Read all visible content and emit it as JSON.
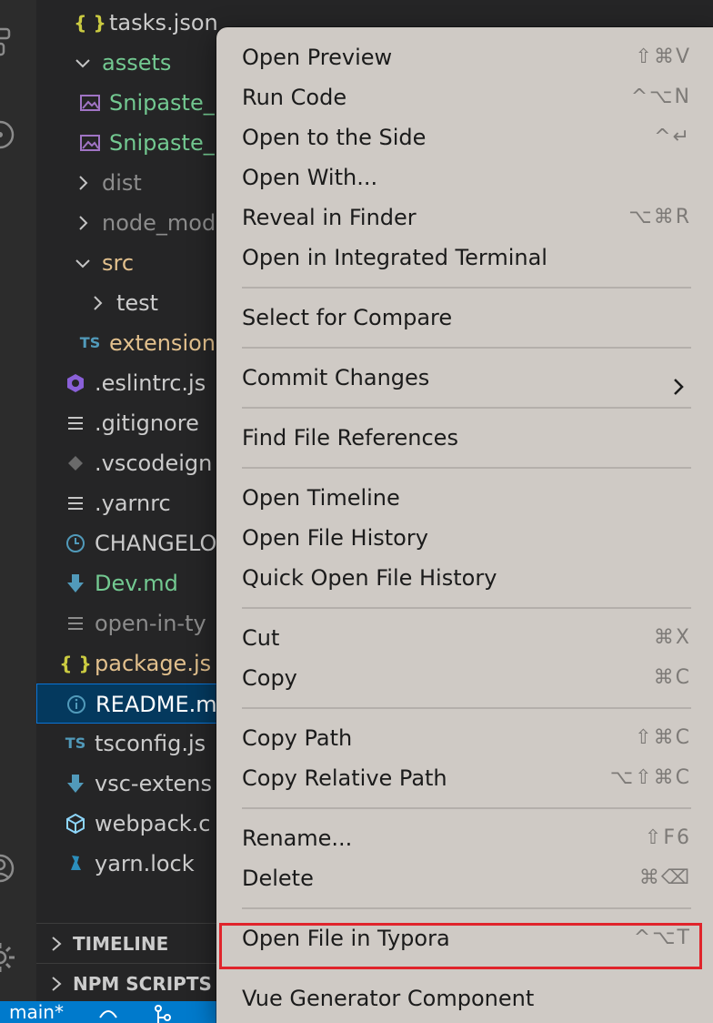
{
  "explorer": {
    "tree": [
      {
        "label": "tasks.json",
        "icon": "json-braces-icon",
        "icon_glyph": "{ }",
        "color": "#cccccc",
        "icon_color": "#cbcb41"
      },
      {
        "label": "assets",
        "icon": "chevron-down-icon",
        "color": "#73c991"
      },
      {
        "label": "Snipaste_",
        "icon": "image-icon",
        "color": "#73c991",
        "icon_color": "#a074c4"
      },
      {
        "label": "Snipaste_",
        "icon": "image-icon",
        "color": "#73c991",
        "icon_color": "#a074c4"
      },
      {
        "label": "dist",
        "icon": "chevron-right-icon",
        "color": "#8c8c8c"
      },
      {
        "label": "node_mod",
        "icon": "chevron-right-icon",
        "color": "#8c8c8c"
      },
      {
        "label": "src",
        "icon": "chevron-down-icon",
        "color": "#e2c08d"
      },
      {
        "label": "test",
        "icon": "chevron-right-icon",
        "color": "#cccccc"
      },
      {
        "label": "extension",
        "icon": "typescript-icon",
        "icon_glyph": "TS",
        "color": "#e2c08d",
        "icon_color": "#519aba"
      },
      {
        "label": ".eslintrc.js",
        "icon": "eslint-icon",
        "color": "#cccccc",
        "icon_color": "#8a60d8"
      },
      {
        "label": ".gitignore",
        "icon": "lines-icon",
        "color": "#cccccc",
        "icon_color": "#c5c5c5"
      },
      {
        "label": ".vscodeign",
        "icon": "diamond-icon",
        "color": "#cccccc",
        "icon_color": "#6a6a6a"
      },
      {
        "label": ".yarnrc",
        "icon": "lines-icon",
        "color": "#cccccc",
        "icon_color": "#c5c5c5"
      },
      {
        "label": "CHANGELO",
        "icon": "clock-icon",
        "color": "#cccccc",
        "icon_color": "#519aba"
      },
      {
        "label": "Dev.md",
        "icon": "download-arrow-icon",
        "color": "#73c991",
        "icon_color": "#519aba"
      },
      {
        "label": "open-in-ty",
        "icon": "lines-icon",
        "color": "#8c8c8c",
        "icon_color": "#8c8c8c"
      },
      {
        "label": "package.js",
        "icon": "json-braces-icon",
        "icon_glyph": "{ }",
        "color": "#e2c08d",
        "icon_color": "#cbcb41"
      },
      {
        "label": "README.m",
        "icon": "info-icon",
        "color": "#ffffff",
        "icon_color": "#519aba"
      },
      {
        "label": "tsconfig.js",
        "icon": "typescript-icon",
        "icon_glyph": "TS",
        "color": "#cccccc",
        "icon_color": "#519aba"
      },
      {
        "label": "vsc-extens",
        "icon": "download-arrow-icon",
        "color": "#cccccc",
        "icon_color": "#519aba"
      },
      {
        "label": "webpack.c",
        "icon": "cube-icon",
        "color": "#cccccc",
        "icon_color": "#8ed6fb"
      },
      {
        "label": "yarn.lock",
        "icon": "yarn-cat-icon",
        "color": "#cccccc",
        "icon_color": "#2c8ebb"
      }
    ],
    "sections": [
      "TIMELINE",
      "NPM SCRIPTS"
    ]
  },
  "statusbar": {
    "branch": "main*"
  },
  "context_menu": {
    "groups": [
      [
        {
          "label": "Open Preview",
          "shortcut": "⇧⌘V"
        },
        {
          "label": "Run Code",
          "shortcut": "^⌥N"
        },
        {
          "label": "Open to the Side",
          "shortcut": "^↵"
        },
        {
          "label": "Open With...",
          "shortcut": ""
        },
        {
          "label": "Reveal in Finder",
          "shortcut": "⌥⌘R"
        },
        {
          "label": "Open in Integrated Terminal",
          "shortcut": ""
        }
      ],
      [
        {
          "label": "Select for Compare",
          "shortcut": ""
        }
      ],
      [
        {
          "label": "Commit Changes",
          "shortcut": "",
          "submenu": true
        }
      ],
      [
        {
          "label": "Find File References",
          "shortcut": ""
        }
      ],
      [
        {
          "label": "Open Timeline",
          "shortcut": ""
        },
        {
          "label": "Open File History",
          "shortcut": ""
        },
        {
          "label": "Quick Open File History",
          "shortcut": ""
        }
      ],
      [
        {
          "label": "Cut",
          "shortcut": "⌘X"
        },
        {
          "label": "Copy",
          "shortcut": "⌘C"
        }
      ],
      [
        {
          "label": "Copy Path",
          "shortcut": "⇧⌘C"
        },
        {
          "label": "Copy Relative Path",
          "shortcut": "⌥⇧⌘C"
        }
      ],
      [
        {
          "label": "Rename...",
          "shortcut": "⇧F6"
        },
        {
          "label": "Delete",
          "shortcut": "⌘⌫"
        }
      ],
      [
        {
          "label": "Open File in Typora",
          "shortcut": "^⌥T",
          "highlighted": true
        }
      ],
      [
        {
          "label": "Vue Generator Component",
          "shortcut": ""
        }
      ]
    ],
    "highlight_color": "#e0242b"
  }
}
